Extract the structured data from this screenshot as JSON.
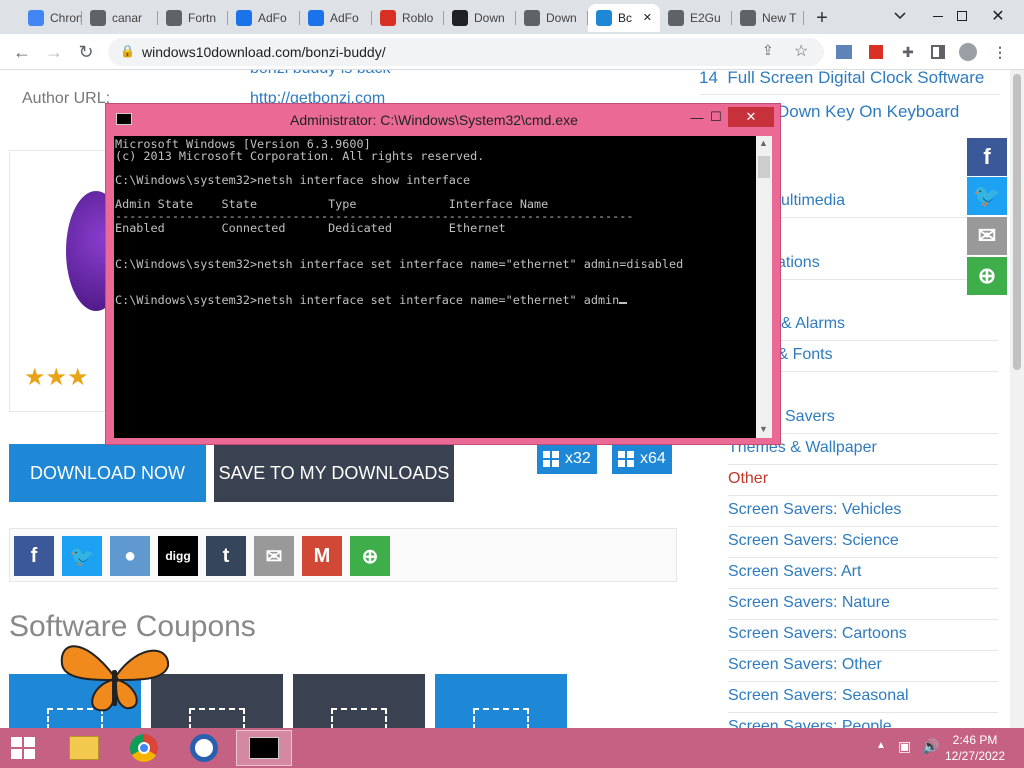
{
  "browser": {
    "tabs": [
      {
        "title": "Chron",
        "fav_color": "#4285f4"
      },
      {
        "title": "canar",
        "fav_color": "#5f6368"
      },
      {
        "title": "Fortn",
        "fav_color": "#5f6368"
      },
      {
        "title": "AdFo",
        "fav_color": "#1a73e8"
      },
      {
        "title": "AdFo",
        "fav_color": "#1a73e8"
      },
      {
        "title": "Roblo",
        "fav_color": "#d93025"
      },
      {
        "title": "Down",
        "fav_color": "#202124"
      },
      {
        "title": "Down",
        "fav_color": "#5f6368"
      },
      {
        "title": "Bc",
        "fav_color": "#1e88d6"
      },
      {
        "title": "E2Gu",
        "fav_color": "#5f6368"
      },
      {
        "title": "New T",
        "fav_color": "#5f6368"
      }
    ],
    "new_tab_label": "+",
    "url": "windows10download.com/bonzi-buddy/"
  },
  "page": {
    "partial_top_text": "bonzi buddy is back",
    "author_label": "Author URL:",
    "author_url": "http://getbonzi.com",
    "buttons": {
      "download_now": "DOWNLOAD NOW",
      "save_to_downloads": "SAVE TO MY DOWNLOADS",
      "x32": "x32",
      "x64": "x64"
    },
    "coupons_title": "Software Coupons",
    "rating_stars": 3
  },
  "sidebar": {
    "numbered": [
      {
        "num": "14",
        "label": "Full Screen Digital Clock Software"
      },
      {
        "num": "",
        "label": "Down Key On Keyboard"
      }
    ],
    "categories": [
      "ultimedia",
      "ations",
      "& Alarms",
      "s & Fonts",
      "Savers",
      "Themes & Wallpaper",
      "Other",
      "Screen Savers: Vehicles",
      "Screen Savers: Science",
      "Screen Savers: Art",
      "Screen Savers: Nature",
      "Screen Savers: Cartoons",
      "Screen Savers: Other",
      "Screen Savers: Seasonal",
      "Screen Savers: People"
    ]
  },
  "cmd": {
    "title": "Administrator: C:\\Windows\\System32\\cmd.exe",
    "lines": [
      "Microsoft Windows [Version 6.3.9600]",
      "(c) 2013 Microsoft Corporation. All rights reserved.",
      "",
      "C:\\Windows\\system32>netsh interface show interface",
      "",
      "Admin State    State          Type             Interface Name",
      "-------------------------------------------------------------------------",
      "Enabled        Connected      Dedicated        Ethernet",
      "",
      "",
      "C:\\Windows\\system32>netsh interface set interface name=\"ethernet\" admin=disabled",
      "",
      "",
      "C:\\Windows\\system32>netsh interface set interface name=\"ethernet\" admin"
    ],
    "minimize": "—",
    "maximize": "☐",
    "close": "✕"
  },
  "taskbar": {
    "time": "2:46 PM",
    "date": "12/27/2022"
  },
  "colors": {
    "accent": "#1e88d6",
    "cmd_frame": "#ea6a95",
    "taskbar": "#c56283",
    "other_category": "#c0392b"
  }
}
